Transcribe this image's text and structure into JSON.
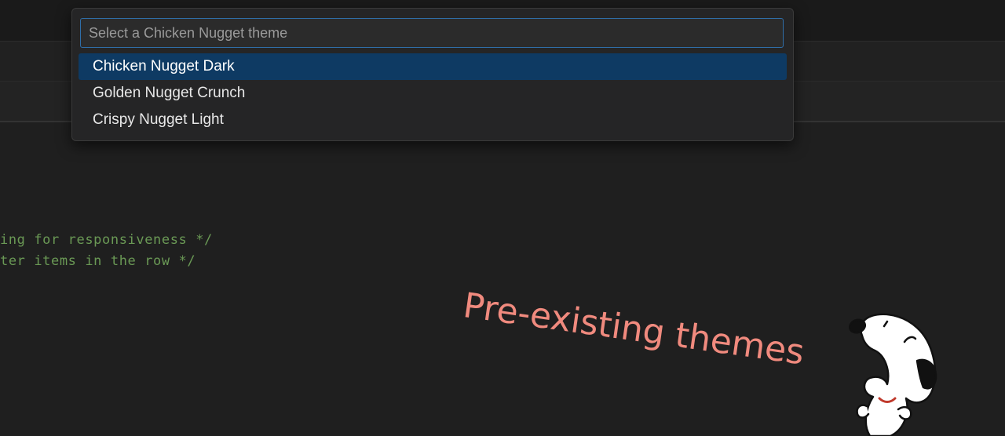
{
  "theme_picker": {
    "placeholder": "Select a Chicken Nugget theme",
    "items": [
      {
        "label": "Chicken Nugget Dark",
        "selected": true
      },
      {
        "label": "Golden Nugget Crunch",
        "selected": false
      },
      {
        "label": "Crispy Nugget Light",
        "selected": false
      }
    ]
  },
  "editor": {
    "code_lines": [
      "ing for responsiveness */",
      "ter items in the row */"
    ],
    "comment_color": "#6a9955"
  },
  "annotation": {
    "text": "Pre-existing themes",
    "color": "#f08a7e"
  },
  "colors": {
    "selection": "#0e3a63",
    "focus_border": "#2f6ea8",
    "background": "#1f1f1f"
  },
  "icons": [
    "snoopy-illustration"
  ]
}
